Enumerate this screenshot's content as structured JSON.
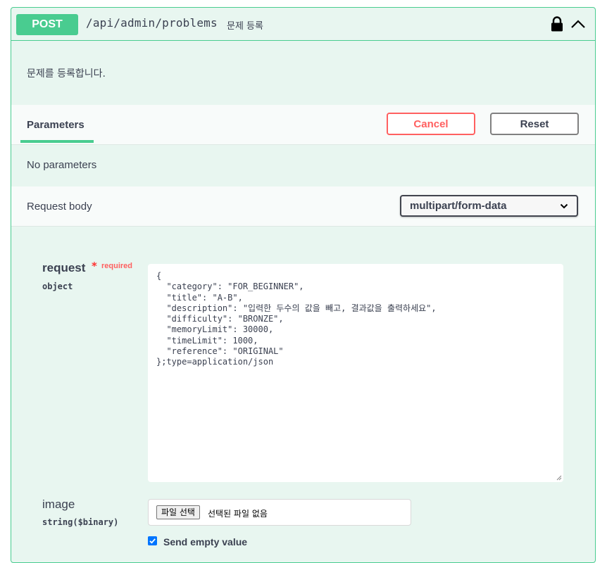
{
  "summary": {
    "method": "POST",
    "path": "/api/admin/problems",
    "description": "문제 등록",
    "lock_icon": "lock-icon",
    "collapse_icon": "chevron-up-icon"
  },
  "operation_description": "문제를 등록합니다.",
  "parameters": {
    "tab_label": "Parameters",
    "cancel_label": "Cancel",
    "reset_label": "Reset",
    "empty_text": "No parameters"
  },
  "request_body": {
    "label": "Request body",
    "content_type": "multipart/form-data"
  },
  "fields": {
    "request": {
      "name": "request",
      "required_star": "*",
      "required_text": "required",
      "type": "object",
      "value": "{\n  \"category\": \"FOR_BEGINNER\",\n  \"title\": \"A-B\",\n  \"description\": \"입력한 두수의 값을 빼고, 결과값을 출력하세요\",\n  \"difficulty\": \"BRONZE\",\n  \"memoryLimit\": 30000,\n  \"timeLimit\": 1000,\n  \"reference\": \"ORIGINAL\"\n};type=application/json"
    },
    "image": {
      "name": "image",
      "type": "string($binary)",
      "file_button": "파일 선택",
      "file_status": "선택된 파일 없음"
    },
    "send_empty_value": {
      "label": "Send empty value",
      "checked": true
    }
  },
  "colors": {
    "post_green": "#49cc90",
    "block_bg": "#e8f6f0",
    "cancel_red": "#ff6060"
  }
}
